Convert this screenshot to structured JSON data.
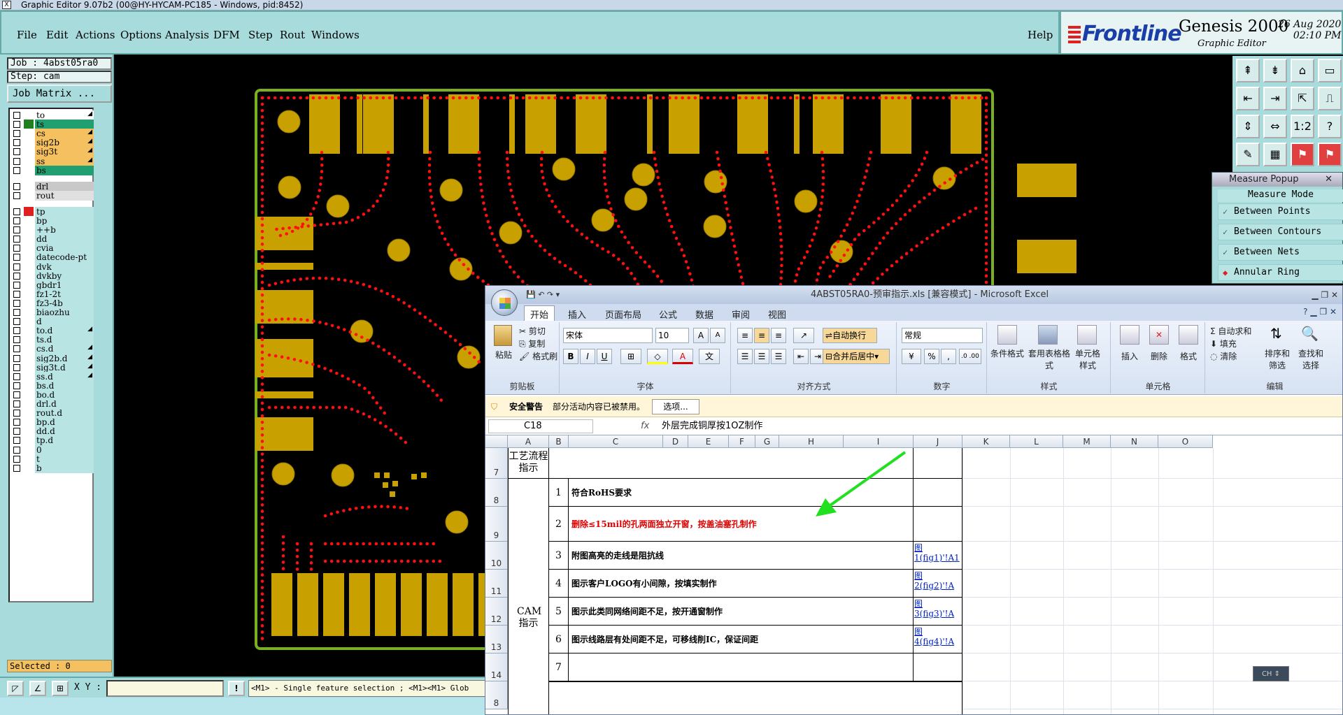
{
  "genesis": {
    "title_bar": "Graphic Editor 9.07b2 (00@HY-HYCAM-PC185 - Windows, pid:8452)",
    "menu": [
      "File",
      "Edit",
      "Actions",
      "Options",
      "Analysis",
      "DFM",
      "Step",
      "Rout",
      "Windows"
    ],
    "help": "Help",
    "brand": {
      "logo": "Frontline",
      "product": "Genesis 2000",
      "subtitle": "Graphic Editor",
      "date": "26 Aug 2020",
      "time": "02:10 PM",
      "color": "#1a3ea8"
    },
    "job": "Job : 4abst05ra0",
    "step": "Step: cam",
    "job_matrix": "Job Matrix ...",
    "layers": [
      {
        "name": "to",
        "color": "#ffffff"
      },
      {
        "name": "ts",
        "color": "#20a070"
      },
      {
        "name": "cs",
        "color": "#f4c060"
      },
      {
        "name": "sig2b",
        "color": "#f4c060"
      },
      {
        "name": "sig3t",
        "color": "#f4c060"
      },
      {
        "name": "ss",
        "color": "#f4c060"
      },
      {
        "name": "bs",
        "color": "#20a070"
      },
      {
        "name": "drl",
        "color": "#c8c8c8"
      },
      {
        "name": "rout",
        "color": "#e0e0e0"
      },
      {
        "name": "tp",
        "color": "#b8e4e4"
      },
      {
        "name": "bp",
        "color": "#b8e4e4"
      },
      {
        "name": "++b",
        "color": "#b8e4e4"
      },
      {
        "name": "dd",
        "color": "#b8e4e4"
      },
      {
        "name": "cvia",
        "color": "#b8e4e4"
      },
      {
        "name": "datecode-pt",
        "color": "#b8e4e4"
      },
      {
        "name": "dvk",
        "color": "#b8e4e4"
      },
      {
        "name": "dvkby",
        "color": "#b8e4e4"
      },
      {
        "name": "gbdr1",
        "color": "#b8e4e4"
      },
      {
        "name": "fz1-2t",
        "color": "#b8e4e4"
      },
      {
        "name": "fz3-4b",
        "color": "#b8e4e4"
      },
      {
        "name": "biaozhu",
        "color": "#b8e4e4"
      },
      {
        "name": "d",
        "color": "#b8e4e4"
      },
      {
        "name": "to.d",
        "color": "#b8e4e4"
      },
      {
        "name": "ts.d",
        "color": "#b8e4e4"
      },
      {
        "name": "cs.d",
        "color": "#b8e4e4"
      },
      {
        "name": "sig2b.d",
        "color": "#b8e4e4"
      },
      {
        "name": "sig3t.d",
        "color": "#b8e4e4"
      },
      {
        "name": "ss.d",
        "color": "#b8e4e4"
      },
      {
        "name": "bs.d",
        "color": "#b8e4e4"
      },
      {
        "name": "bo.d",
        "color": "#b8e4e4"
      },
      {
        "name": "drl.d",
        "color": "#b8e4e4"
      },
      {
        "name": "rout.d",
        "color": "#b8e4e4"
      },
      {
        "name": "bp.d",
        "color": "#b8e4e4"
      },
      {
        "name": "dd.d",
        "color": "#b8e4e4"
      },
      {
        "name": "tp.d",
        "color": "#b8e4e4"
      },
      {
        "name": "0",
        "color": "#b8e4e4"
      },
      {
        "name": "t",
        "color": "#b8e4e4"
      },
      {
        "name": "b",
        "color": "#b8e4e4"
      }
    ],
    "selected": "Selected : 0",
    "xy_label": "X Y :",
    "status": "<M1> - Single feature selection ; <M1><M1> Glob",
    "measure": {
      "title": "Measure Popup",
      "mode": "Measure Mode",
      "items": [
        "Between Points",
        "Between Contours",
        "Between Nets",
        "Annular Ring"
      ]
    },
    "tool_labels": [
      "1:2",
      "?"
    ]
  },
  "excel": {
    "title": "4ABST05RA0-预审指示.xls [兼容模式] - Microsoft Excel",
    "tabs": [
      "开始",
      "插入",
      "页面布局",
      "公式",
      "数据",
      "审阅",
      "视图"
    ],
    "clipboard": {
      "paste": "粘贴",
      "cut": "剪切",
      "copy": "复制",
      "format_painter": "格式刷",
      "label": "剪贴板"
    },
    "font": {
      "name": "宋体",
      "size": "10",
      "label": "字体",
      "bold": "B",
      "italic": "I",
      "underline": "U"
    },
    "alignment": {
      "wrap": "自动换行",
      "merge": "合并后居中",
      "label": "对齐方式"
    },
    "number": {
      "format": "常规",
      "label": "数字",
      "percent": "%"
    },
    "styles": {
      "cond": "条件格式",
      "table": "套用表格格式",
      "cell": "单元格样式",
      "label": "样式"
    },
    "cells": {
      "insert": "插入",
      "delete": "删除",
      "format": "格式",
      "label": "单元格"
    },
    "editing": {
      "autosum": "自动求和",
      "fill": "填充",
      "clear": "清除",
      "sort": "排序和筛选",
      "find": "查找和选择",
      "label": "编辑"
    },
    "security": {
      "title": "安全警告",
      "msg": "部分活动内容已被禁用。",
      "button": "选项..."
    },
    "name_box": "C18",
    "formula": "外层完成铜厚按1OZ制作",
    "fx": "fx",
    "columns": [
      "A",
      "B",
      "C",
      "D",
      "E",
      "F",
      "G",
      "H",
      "I",
      "J",
      "K",
      "L",
      "M",
      "N",
      "O"
    ],
    "row_numbers": [
      "7",
      "8",
      "9",
      "10",
      "11",
      "12",
      "13",
      "14",
      "8"
    ],
    "a7": "工艺流程指示",
    "a_cam": "CAM指示",
    "rows": [
      {
        "num": "1",
        "text": "符合RoHS要求",
        "link": ""
      },
      {
        "num": "2",
        "text": "删除≤15mil的孔两面独立开窗，按盖油塞孔制作",
        "link": ""
      },
      {
        "num": "3",
        "text": "附图高亮的走线是阻抗线",
        "link": "图1(fig1)'!A1"
      },
      {
        "num": "4",
        "text": "图示客户LOGO有小间隙，按填实制作",
        "link": "图2(fig2)'!A"
      },
      {
        "num": "5",
        "text": "图示此类同网络间距不足，按开通窗制作",
        "link": "图3(fig3)'!A"
      },
      {
        "num": "6",
        "text": "图示线路层有处间距不足，可移线削IC，保证间距",
        "link": "图4(fig4)'!A"
      },
      {
        "num": "7",
        "text": "",
        "link": ""
      }
    ],
    "ime": "CH",
    "colors": {
      "red_text": "#e00000",
      "arrow": "#20e020"
    }
  }
}
